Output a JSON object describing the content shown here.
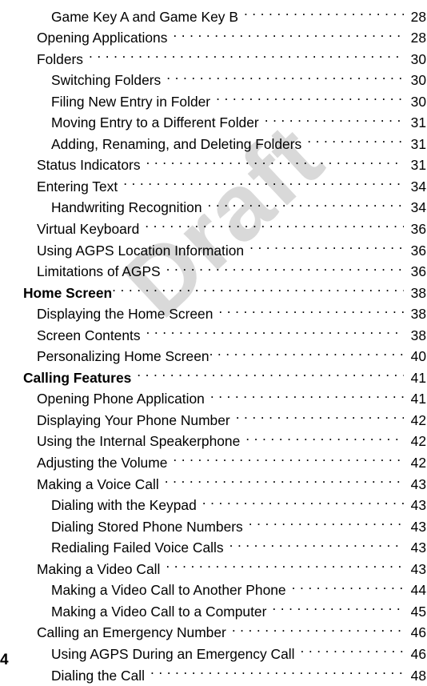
{
  "document": {
    "type": "table-of-contents",
    "page_number": "4",
    "watermark": {
      "text": "Draft",
      "color": "#d9d9d9",
      "rotation_deg": -43
    },
    "background_color": "#ffffff",
    "text_color": "#000000"
  },
  "toc": {
    "entries": [
      {
        "title": "Game Key A and Game Key B",
        "page": "28",
        "level": 2,
        "bold": false,
        "gap": true
      },
      {
        "title": "Opening Applications",
        "page": "28",
        "level": 1,
        "bold": false,
        "gap": true
      },
      {
        "title": "Folders",
        "page": "30",
        "level": 1,
        "bold": false,
        "gap": true
      },
      {
        "title": "Switching Folders",
        "page": "30",
        "level": 2,
        "bold": false,
        "gap": true
      },
      {
        "title": "Filing New Entry in Folder",
        "page": "30",
        "level": 2,
        "bold": false,
        "gap": true
      },
      {
        "title": "Moving Entry to a Different Folder",
        "page": "31",
        "level": 2,
        "bold": false,
        "gap": true
      },
      {
        "title": "Adding, Renaming, and Deleting Folders",
        "page": "31",
        "level": 2,
        "bold": false,
        "gap": true
      },
      {
        "title": "Status Indicators",
        "page": "31",
        "level": 1,
        "bold": false,
        "gap": true
      },
      {
        "title": "Entering Text",
        "page": "34",
        "level": 1,
        "bold": false,
        "gap": true
      },
      {
        "title": "Handwriting Recognition",
        "page": "34",
        "level": 2,
        "bold": false,
        "gap": true
      },
      {
        "title": "Virtual Keyboard",
        "page": "36",
        "level": 1,
        "bold": false,
        "gap": true
      },
      {
        "title": "Using AGPS Location Information",
        "page": "36",
        "level": 1,
        "bold": false,
        "gap": true
      },
      {
        "title": "Limitations of AGPS",
        "page": "36",
        "level": 1,
        "bold": false,
        "gap": true
      },
      {
        "title": "Home Screen",
        "page": "38",
        "level": 0,
        "bold": true,
        "gap": false
      },
      {
        "title": "Displaying the Home Screen",
        "page": "38",
        "level": 1,
        "bold": false,
        "gap": true
      },
      {
        "title": "Screen Contents",
        "page": "38",
        "level": 1,
        "bold": false,
        "gap": true
      },
      {
        "title": "Personalizing Home Screen",
        "page": "40",
        "level": 1,
        "bold": false,
        "gap": false
      },
      {
        "title": "Calling Features",
        "page": "41",
        "level": 0,
        "bold": true,
        "gap": true
      },
      {
        "title": "Opening Phone Application",
        "page": "41",
        "level": 1,
        "bold": false,
        "gap": true
      },
      {
        "title": "Displaying Your Phone Number",
        "page": "42",
        "level": 1,
        "bold": false,
        "gap": true
      },
      {
        "title": "Using the Internal Speakerphone",
        "page": "42",
        "level": 1,
        "bold": false,
        "gap": true
      },
      {
        "title": "Adjusting the Volume",
        "page": "42",
        "level": 1,
        "bold": false,
        "gap": true
      },
      {
        "title": "Making a Voice Call",
        "page": "43",
        "level": 1,
        "bold": false,
        "gap": true
      },
      {
        "title": "Dialing with the Keypad",
        "page": "43",
        "level": 2,
        "bold": false,
        "gap": true
      },
      {
        "title": "Dialing Stored Phone Numbers",
        "page": "43",
        "level": 2,
        "bold": false,
        "gap": true
      },
      {
        "title": "Redialing Failed Voice Calls",
        "page": "43",
        "level": 2,
        "bold": false,
        "gap": true
      },
      {
        "title": "Making a Video Call",
        "page": "43",
        "level": 1,
        "bold": false,
        "gap": true
      },
      {
        "title": "Making a Video Call to Another Phone",
        "page": "44",
        "level": 2,
        "bold": false,
        "gap": true
      },
      {
        "title": "Making a Video Call to a Computer",
        "page": "45",
        "level": 2,
        "bold": false,
        "gap": true
      },
      {
        "title": "Calling an Emergency Number",
        "page": "46",
        "level": 1,
        "bold": false,
        "gap": true
      },
      {
        "title": "Using AGPS During an Emergency Call",
        "page": "46",
        "level": 2,
        "bold": false,
        "gap": true
      },
      {
        "title": "Dialing the Call",
        "page": "48",
        "level": 2,
        "bold": false,
        "gap": true
      }
    ]
  }
}
